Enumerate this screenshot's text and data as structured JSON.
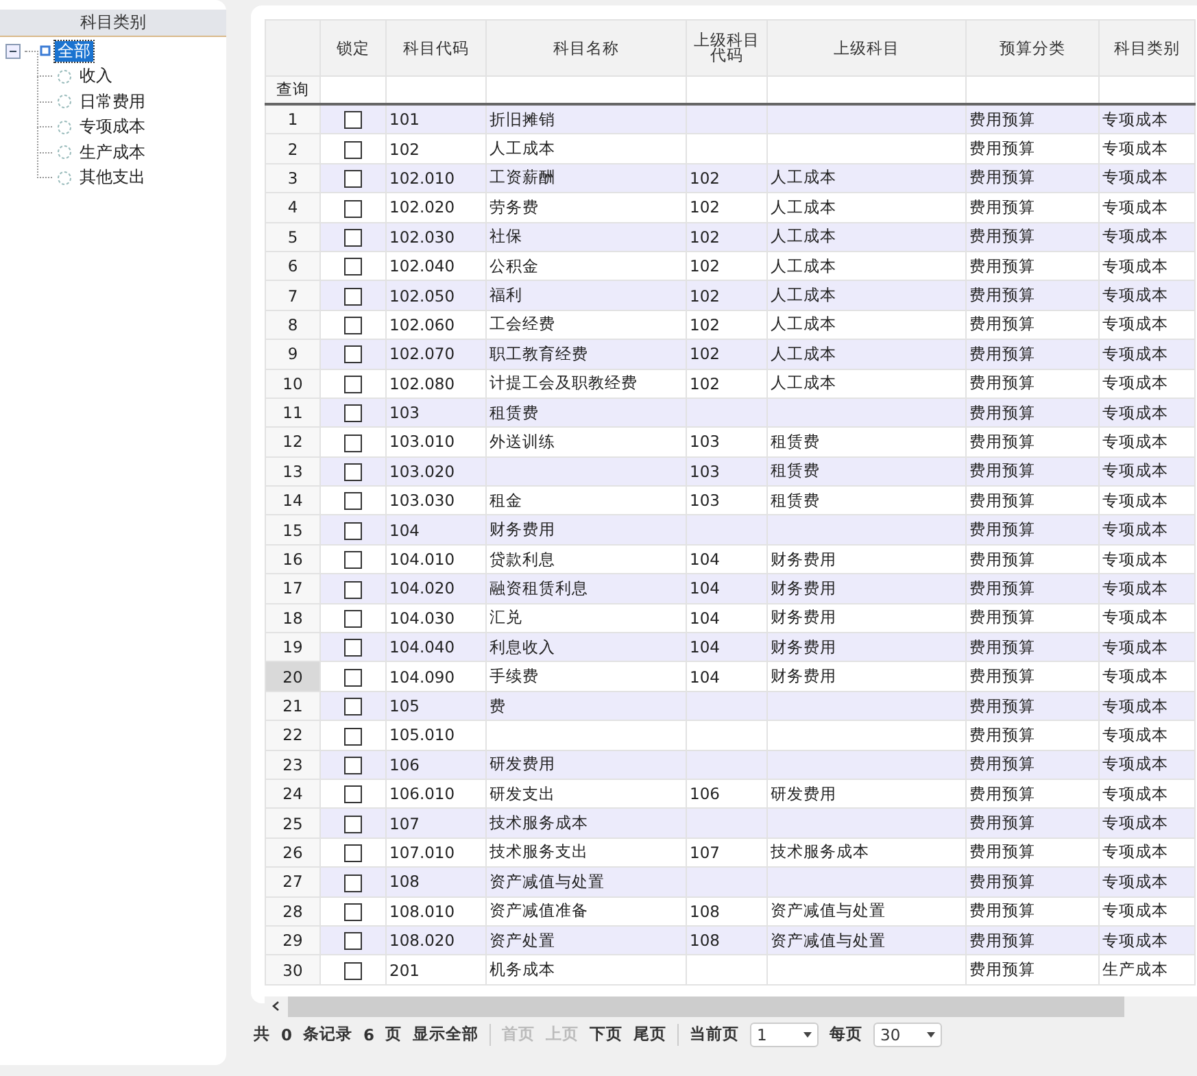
{
  "sidebar": {
    "title": "科目类别",
    "tree": {
      "label": "全部",
      "selected": true,
      "expanded": true,
      "children": [
        {
          "label": "收入",
          "selected": false
        },
        {
          "label": "日常费用",
          "selected": false
        },
        {
          "label": "专项成本",
          "selected": false
        },
        {
          "label": "生产成本",
          "selected": false
        },
        {
          "label": "其他支出",
          "selected": false
        }
      ]
    }
  },
  "table": {
    "columns": [
      "锁定",
      "科目代码",
      "科目名称",
      "上级科目代码",
      "上级科目",
      "预算分类",
      "科目类别"
    ],
    "filter_label": "查询",
    "rows": [
      {
        "index": "1",
        "selected": false,
        "locked": false,
        "code": "101",
        "name": "折旧摊销",
        "budget": "费用预算",
        "category": "专项成本"
      },
      {
        "index": "2",
        "selected": false,
        "locked": false,
        "code": "102",
        "name": "人工成本",
        "budget": "费用预算",
        "category": "专项成本"
      },
      {
        "index": "3",
        "selected": false,
        "locked": false,
        "code": "102.010",
        "name": "工资薪酬",
        "parent_code": "102",
        "parent": "人工成本",
        "budget": "费用预算",
        "category": "专项成本"
      },
      {
        "index": "4",
        "selected": false,
        "locked": false,
        "code": "102.020",
        "name": "劳务费",
        "parent_code": "102",
        "parent": "人工成本",
        "budget": "费用预算",
        "category": "专项成本"
      },
      {
        "index": "5",
        "selected": false,
        "locked": false,
        "code": "102.030",
        "name": "社保",
        "parent_code": "102",
        "parent": "人工成本",
        "budget": "费用预算",
        "category": "专项成本"
      },
      {
        "index": "6",
        "selected": false,
        "locked": false,
        "code": "102.040",
        "name": "公积金",
        "parent_code": "102",
        "parent": "人工成本",
        "budget": "费用预算",
        "category": "专项成本"
      },
      {
        "index": "7",
        "selected": false,
        "locked": false,
        "code": "102.050",
        "name": "福利",
        "parent_code": "102",
        "parent": "人工成本",
        "budget": "费用预算",
        "category": "专项成本"
      },
      {
        "index": "8",
        "selected": false,
        "locked": false,
        "code": "102.060",
        "name": "工会经费",
        "parent_code": "102",
        "parent": "人工成本",
        "budget": "费用预算",
        "category": "专项成本"
      },
      {
        "index": "9",
        "selected": false,
        "locked": false,
        "code": "102.070",
        "name": "职工教育经费",
        "parent_code": "102",
        "parent": "人工成本",
        "budget": "费用预算",
        "category": "专项成本"
      },
      {
        "index": "10",
        "selected": false,
        "locked": false,
        "code": "102.080",
        "name": "计提工会及职教经费",
        "parent_code": "102",
        "parent": "人工成本",
        "budget": "费用预算",
        "category": "专项成本"
      },
      {
        "index": "11",
        "selected": false,
        "locked": false,
        "code": "103",
        "name": "租赁费",
        "budget": "费用预算",
        "category": "专项成本"
      },
      {
        "index": "12",
        "selected": false,
        "locked": false,
        "code": "103.010",
        "name": "外送训练",
        "parent_code": "103",
        "parent": "租赁费",
        "budget": "费用预算",
        "category": "专项成本"
      },
      {
        "index": "13",
        "selected": false,
        "locked": false,
        "code": "103.020",
        "parent_code": "103",
        "parent": "租赁费",
        "budget": "费用预算",
        "category": "专项成本"
      },
      {
        "index": "14",
        "selected": false,
        "locked": false,
        "code": "103.030",
        "name": "租金",
        "parent_code": "103",
        "parent": "租赁费",
        "budget": "费用预算",
        "category": "专项成本"
      },
      {
        "index": "15",
        "selected": false,
        "locked": false,
        "code": "104",
        "name": "财务费用",
        "budget": "费用预算",
        "category": "专项成本"
      },
      {
        "index": "16",
        "selected": false,
        "locked": false,
        "code": "104.010",
        "name": "贷款利息",
        "parent_code": "104",
        "parent": "财务费用",
        "budget": "费用预算",
        "category": "专项成本"
      },
      {
        "index": "17",
        "selected": false,
        "locked": false,
        "code": "104.020",
        "name": "融资租赁利息",
        "parent_code": "104",
        "parent": "财务费用",
        "budget": "费用预算",
        "category": "专项成本"
      },
      {
        "index": "18",
        "selected": false,
        "locked": false,
        "code": "104.030",
        "name": "汇兑",
        "parent_code": "104",
        "parent": "财务费用",
        "budget": "费用预算",
        "category": "专项成本"
      },
      {
        "index": "19",
        "selected": false,
        "locked": false,
        "code": "104.040",
        "name": "利息收入",
        "parent_code": "104",
        "parent": "财务费用",
        "budget": "费用预算",
        "category": "专项成本"
      },
      {
        "index": "20",
        "selected": true,
        "locked": false,
        "code": "104.090",
        "name": "手续费",
        "parent_code": "104",
        "parent": "财务费用",
        "budget": "费用预算",
        "category": "专项成本"
      },
      {
        "index": "21",
        "selected": false,
        "locked": false,
        "code": "105",
        "name": "费",
        "budget": "费用预算",
        "category": "专项成本"
      },
      {
        "index": "22",
        "selected": false,
        "locked": false,
        "code": "105.010",
        "budget": "费用预算",
        "category": "专项成本"
      },
      {
        "index": "23",
        "selected": false,
        "locked": false,
        "code": "106",
        "name": "研发费用",
        "budget": "费用预算",
        "category": "专项成本"
      },
      {
        "index": "24",
        "selected": false,
        "locked": false,
        "code": "106.010",
        "name": "研发支出",
        "parent_code": "106",
        "parent": "研发费用",
        "budget": "费用预算",
        "category": "专项成本"
      },
      {
        "index": "25",
        "selected": false,
        "locked": false,
        "code": "107",
        "name": "技术服务成本",
        "budget": "费用预算",
        "category": "专项成本"
      },
      {
        "index": "26",
        "selected": false,
        "locked": false,
        "code": "107.010",
        "name": "技术服务支出",
        "parent_code": "107",
        "parent": "技术服务成本",
        "budget": "费用预算",
        "category": "专项成本"
      },
      {
        "index": "27",
        "selected": false,
        "locked": false,
        "code": "108",
        "name": "资产减值与处置",
        "budget": "费用预算",
        "category": "专项成本"
      },
      {
        "index": "28",
        "selected": false,
        "locked": false,
        "code": "108.010",
        "name": "资产减值准备",
        "parent_code": "108",
        "parent": "资产减值与处置",
        "budget": "费用预算",
        "category": "专项成本"
      },
      {
        "index": "29",
        "selected": false,
        "locked": false,
        "code": "108.020",
        "name": "资产处置",
        "parent_code": "108",
        "parent": "资产减值与处置",
        "budget": "费用预算",
        "category": "专项成本"
      },
      {
        "index": "30",
        "selected": false,
        "locked": false,
        "code": "201",
        "name": "机务成本",
        "budget": "费用预算",
        "category": "生产成本"
      }
    ]
  },
  "pager": {
    "items": [
      {
        "kind": "text",
        "label": "共"
      },
      {
        "kind": "text",
        "label": "0"
      },
      {
        "kind": "text",
        "label": "条记录"
      },
      {
        "kind": "text",
        "label": "6"
      },
      {
        "kind": "text",
        "label": "页"
      },
      {
        "kind": "link",
        "label": "显示全部",
        "disabled": false
      },
      {
        "kind": "sep"
      },
      {
        "kind": "link",
        "label": "首页",
        "disabled": true
      },
      {
        "kind": "link",
        "label": "上页",
        "disabled": true
      },
      {
        "kind": "link",
        "label": "下页",
        "disabled": false
      },
      {
        "kind": "link",
        "label": "尾页",
        "disabled": false
      },
      {
        "kind": "sep"
      },
      {
        "kind": "text",
        "label": "当前页"
      },
      {
        "kind": "select",
        "value": "1"
      },
      {
        "kind": "text",
        "label": "每页"
      },
      {
        "kind": "select",
        "value": "30"
      }
    ]
  }
}
